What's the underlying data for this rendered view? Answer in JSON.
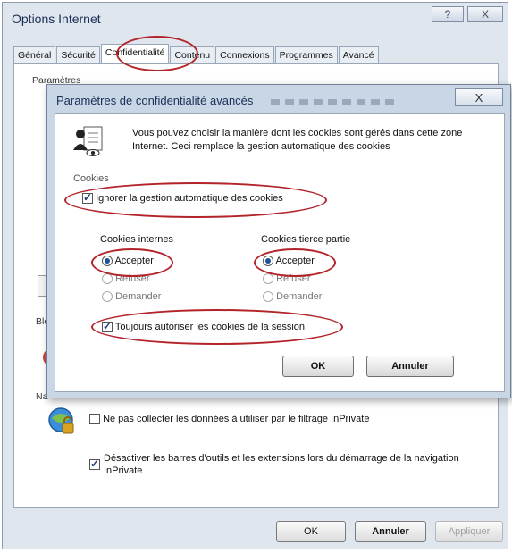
{
  "window": {
    "title": "Options Internet",
    "help_glyph": "?",
    "close_glyph": "X"
  },
  "tabs": [
    "Général",
    "Sécurité",
    "Confidentialité",
    "Contenu",
    "Connexions",
    "Programmes",
    "Avancé"
  ],
  "panel": {
    "parametres_label": "Paramètres",
    "bloqueur_label": "Blo",
    "navigation_label": "Na",
    "inprivate": {
      "no_collect_label": "Ne pas collecter les données à utiliser par le filtrage InPrivate",
      "no_collect_checked": false,
      "disable_toolbars_label": "Désactiver les barres d'outils et les extensions lors du démarrage de la navigation InPrivate",
      "disable_toolbars_checked": true
    }
  },
  "buttons": {
    "ok": "OK",
    "cancel": "Annuler",
    "apply": "Appliquer"
  },
  "dialog": {
    "title": "Paramètres de confidentialité avancés",
    "close_glyph": "X",
    "description": "Vous pouvez choisir la manière dont les cookies sont gérés dans cette zone Internet. Ceci remplace la gestion automatique des cookies",
    "cookies_group_label": "Cookies",
    "override_label": "Ignorer la gestion automatique des cookies",
    "override_checked": true,
    "first_party": {
      "title": "Cookies internes",
      "options": [
        "Accepter",
        "Refuser",
        "Demander"
      ],
      "selected": "Accepter"
    },
    "third_party": {
      "title": "Cookies tierce partie",
      "options": [
        "Accepter",
        "Refuser",
        "Demander"
      ],
      "selected": "Accepter"
    },
    "session_label": "Toujours autoriser les cookies de la session",
    "session_checked": true,
    "ok": "OK",
    "cancel": "Annuler"
  },
  "icons": [
    "privacy-person-icon",
    "inprivate-icon",
    "checkbox-icon",
    "radio-icon"
  ],
  "colors": {
    "annotation": "#b3232a",
    "dialog_frame": "#c9d6e6",
    "window_frame": "#dfe6ee"
  }
}
